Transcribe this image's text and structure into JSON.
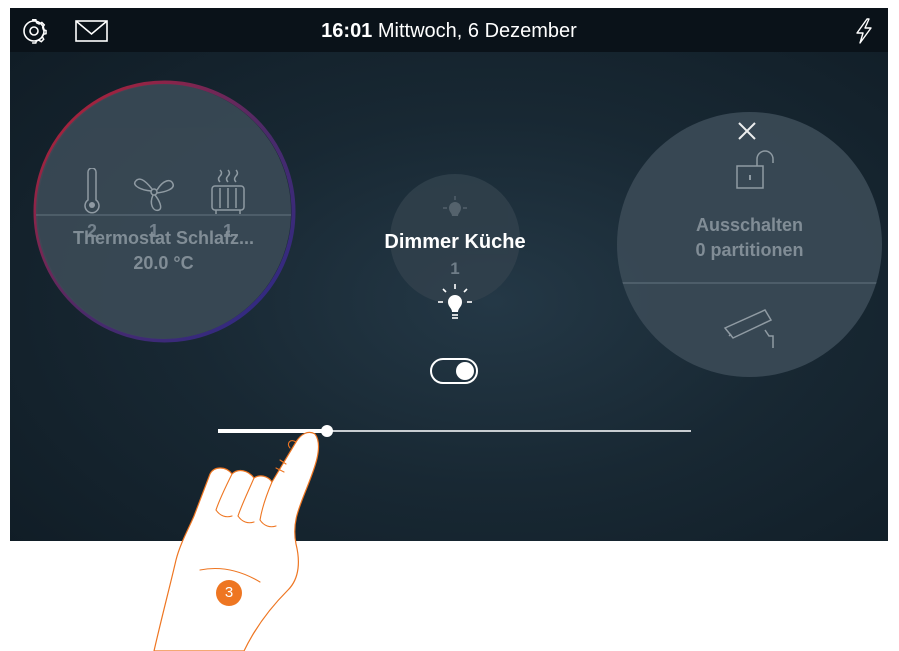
{
  "header": {
    "time": "16:01",
    "date": "Mittwoch, 6 Dezember",
    "icons": [
      "gear-icon",
      "mail-icon",
      "lightning-icon"
    ]
  },
  "thermostat": {
    "counts": {
      "temperature": "2",
      "fan": "1",
      "heater": "1"
    },
    "name": "Thermostat Schlafz...",
    "temperature": "20.0 °C"
  },
  "dimmer": {
    "name": "Dimmer Küche",
    "count": "1",
    "switch_on": true,
    "level": 0.23
  },
  "alarm": {
    "status": "Ausschalten",
    "partitions": "0 partitionen"
  },
  "step_badge": "3",
  "colors": {
    "accent_orange": "#ee7622",
    "ring_red": "#c0202e",
    "ring_blue": "#2a2a8a",
    "topbar": "#0a1219"
  }
}
